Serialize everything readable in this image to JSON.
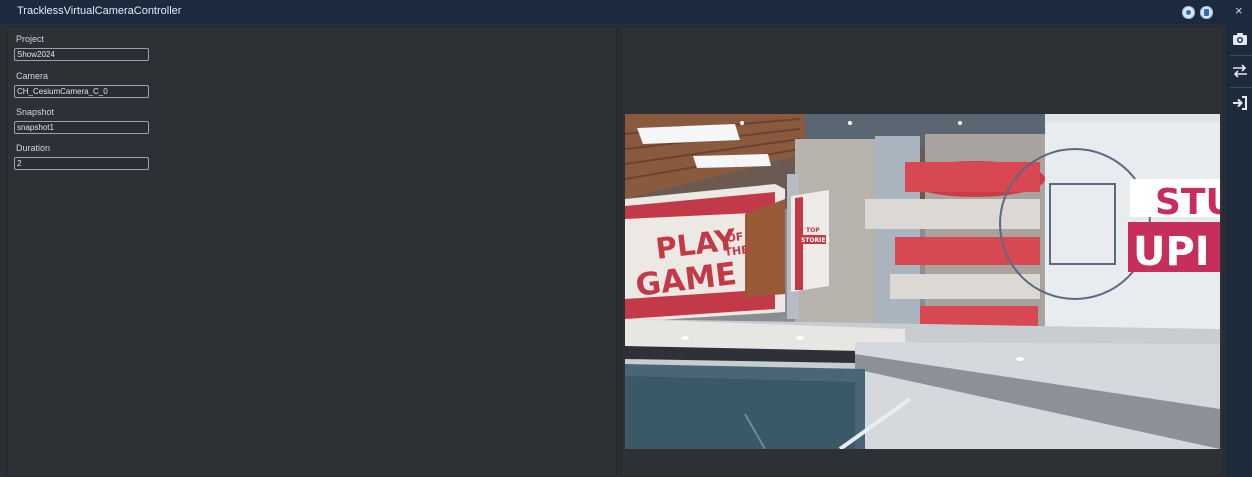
{
  "window": {
    "title": "TracklessVirtualCameraController",
    "close_glyph": "×"
  },
  "form": {
    "project": {
      "label": "Project",
      "value": "Show2024"
    },
    "camera": {
      "label": "Camera",
      "value": "CH_CesiumCamera_C_0"
    },
    "snapshot": {
      "label": "Snapshot",
      "value": "snapshot1"
    },
    "duration": {
      "label": "Duration",
      "value": "2"
    }
  },
  "toolbar": {
    "items": [
      "camera-icon",
      "swap-arrows-icon",
      "sign-in-icon"
    ]
  },
  "preview": {
    "wall_left": {
      "line1": "PLAY",
      "of": "OF",
      "the": "THE",
      "line2": "GAME"
    },
    "sign_small": {
      "line1": "TOP",
      "line2": "STORIES"
    },
    "wall_right": {
      "line1": "STU",
      "line2": "UPI"
    }
  },
  "colors": {
    "titlebar": "#1b2a3f",
    "panel": "#2d3035",
    "accent_red": "#c23a48"
  }
}
